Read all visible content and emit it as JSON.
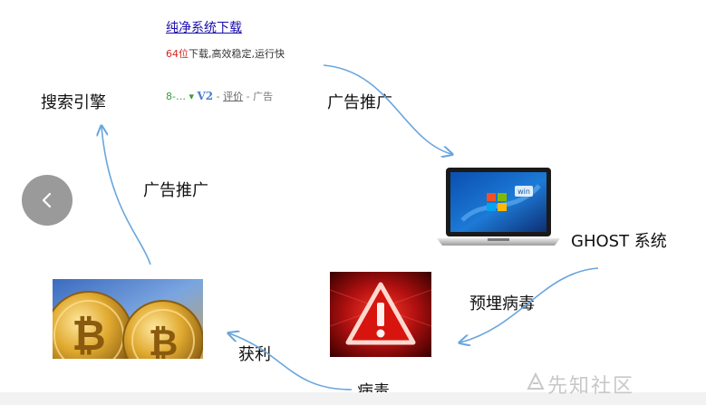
{
  "ad": {
    "title": "纯净系统下载",
    "desc_highlight": "64位",
    "desc_rest": "下载,高效稳定,运行快",
    "meta_rating": "8-…",
    "meta_arrow": "▾",
    "meta_v": "V2",
    "meta_sep1": " - ",
    "meta_review": "评价",
    "meta_sep2": " - ",
    "meta_ad": "广告"
  },
  "nodes": {
    "search_engine": "搜索引擎",
    "ghost_system": "GHOST 系统",
    "profit_source_coins": "",
    "virus_warning": ""
  },
  "edges": {
    "promo_top": "广告推广",
    "promo_left": "广告推广",
    "implant_virus": "预埋病毒",
    "virus": "病毒",
    "profit": "获利"
  },
  "nav": {
    "prev_icon": "chevron-left-icon"
  },
  "watermark": "先知社区",
  "colors": {
    "arrow": "#6aa6dd",
    "link": "#1a0dab",
    "alert_red": "#c4171c"
  }
}
